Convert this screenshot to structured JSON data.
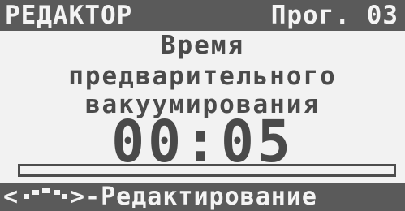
{
  "header": {
    "title": "РЕДАКТОР",
    "program": "Прог. 03"
  },
  "parameter": {
    "line1": "Время",
    "line2": "предварительного",
    "line3": "вакуумирования",
    "value": "00:05"
  },
  "progress": {
    "fraction": 0.0
  },
  "footer": {
    "bracket_open": "<",
    "knob_icon": "rotary-knob-icon",
    "action": ">-Редактирование"
  },
  "colors": {
    "screen_bg": "#f2f2f2",
    "bar_bg": "#5a5a5a",
    "text": "#4a4a4a",
    "bar_text": "#f4f4f4"
  }
}
